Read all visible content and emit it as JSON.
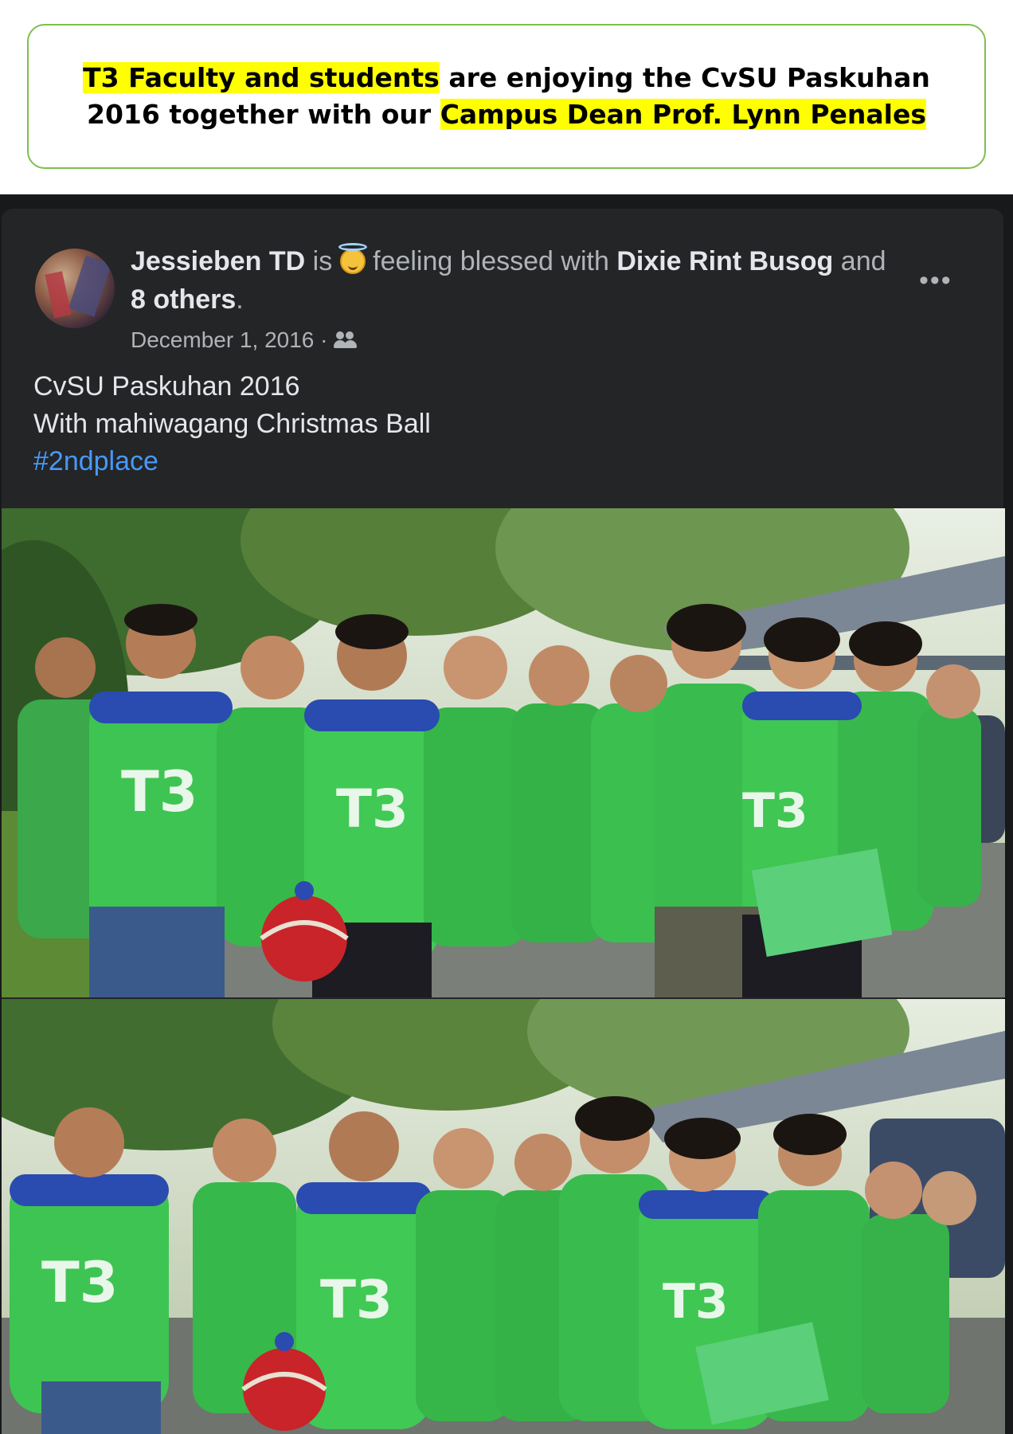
{
  "caption": {
    "part1_highlighted": "T3 Faculty and students",
    "part2": " are enjoying the CvSU Paskuhan 2016 together with our ",
    "part3_highlighted": "Campus Dean Prof. Lynn Penales"
  },
  "post": {
    "author": "Jessieben TD",
    "is_text": " is ",
    "feeling_text": " feeling blessed with ",
    "tagged_person": "Dixie Rint Busog",
    "and_text": " and ",
    "others": "8 others",
    "period": ".",
    "date": "December 1, 2016",
    "date_separator": " · ",
    "emoji_icon": "smiling-face-with-halo-icon",
    "audience_icon": "friends-icon",
    "more_label": "•••",
    "text_line1": "CvSU Paskuhan 2016",
    "text_line2": "With mahiwagang Christmas Ball",
    "hashtag": "#2ndplace"
  },
  "colors": {
    "highlight": "#ffff00",
    "card_bg": "#242526",
    "hashtag": "#4599ff",
    "jersey_green": "#35c24a"
  }
}
